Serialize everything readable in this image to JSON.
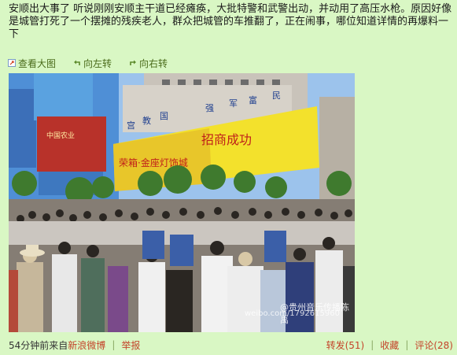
{
  "post": {
    "text": "安顺出大事了 听说刚刚安顺主干道已经瘫痪，大批特警和武警出动，并动用了高压水枪。原因好像是城管打死了一个摆摊的残疾老人，群众把城管的车推翻了，正在闹事，哪位知道详情的再爆料一下"
  },
  "toolbar": {
    "view_large": "查看大图",
    "rotate_left": "向左转",
    "rotate_right": "向右转"
  },
  "photo": {
    "sign_text": "招商成功",
    "sign_left": "荣箱·金座灯饰城",
    "banner_chars": [
      "强",
      "军",
      "富",
      "民",
      "宫",
      "教",
      "强"
    ],
    "store_sign": "中国农业",
    "watermark_name": "@贵州音乐传播陈禹",
    "watermark_url": "weibo.com/1792615960"
  },
  "footer": {
    "time": "54分钟前",
    "from": "来自",
    "source": "新浪微博",
    "report": "举报",
    "repost": "转发(51)",
    "favorite": "收藏",
    "comment": "评论(28)"
  },
  "colors": {
    "background": "#d9f7c4",
    "link": "#c4442a",
    "tool": "#4a6b1a"
  }
}
